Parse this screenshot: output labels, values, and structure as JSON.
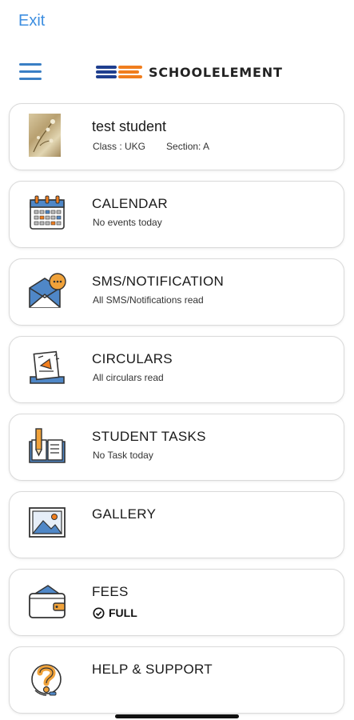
{
  "header": {
    "exit_label": "Exit",
    "brand_name": "SCHOOLELEMENT"
  },
  "profile": {
    "name": "test student",
    "class_text": "Class : UKG",
    "section_text": "Section: A"
  },
  "cards": [
    {
      "icon": "calendar-icon",
      "title": "CALENDAR",
      "subtitle": "No events today"
    },
    {
      "icon": "envelope-chat-icon",
      "title": "SMS/NOTIFICATION",
      "subtitle": "All SMS/Notifications read"
    },
    {
      "icon": "circular-document-icon",
      "title": "CIRCULARS",
      "subtitle": "All circulars read"
    },
    {
      "icon": "book-pencil-icon",
      "title": "STUDENT TASKS",
      "subtitle": "No Task today"
    },
    {
      "icon": "picture-icon",
      "title": "GALLERY",
      "subtitle": ""
    },
    {
      "icon": "wallet-icon",
      "title": "FEES",
      "status": "FULL",
      "status_icon": "check-circle-icon"
    },
    {
      "icon": "help-question-icon",
      "title": "HELP & SUPPORT",
      "subtitle": ""
    }
  ],
  "colors": {
    "accent_blue": "#3d8ee0",
    "logo_orange": "#f07e1e",
    "logo_navy": "#1f3f8f",
    "card_border": "#dadada"
  }
}
